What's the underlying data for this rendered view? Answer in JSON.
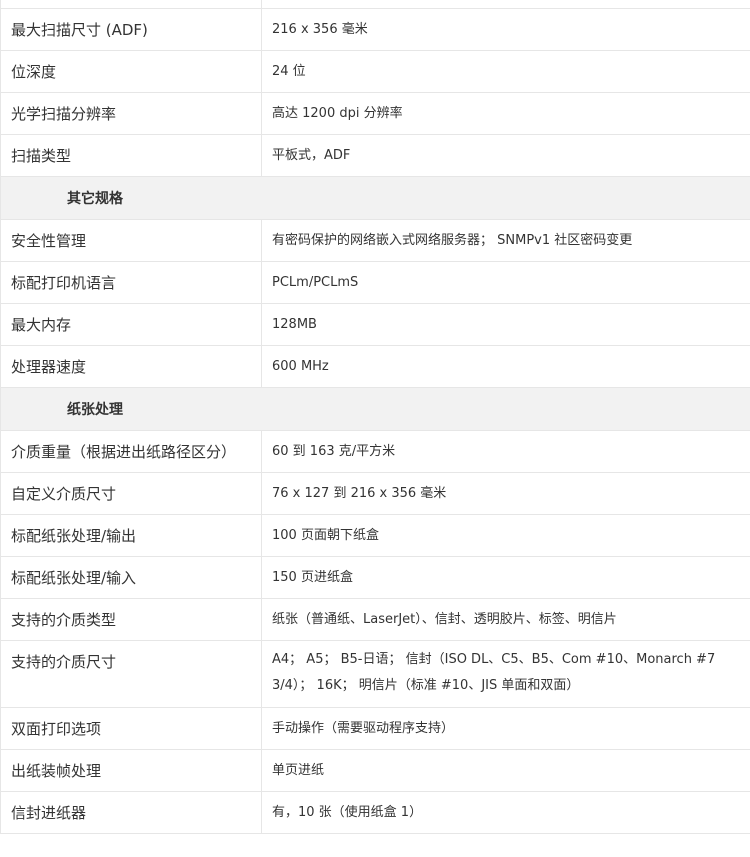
{
  "scan_specs": [
    {
      "label": "最大扫描尺寸 (ADF)",
      "value": "216 x 356 毫米"
    },
    {
      "label": "位深度",
      "value": "24 位"
    },
    {
      "label": "光学扫描分辨率",
      "value": "高达 1200 dpi 分辨率"
    },
    {
      "label": "扫描类型",
      "value": "平板式，ADF"
    }
  ],
  "other_section": {
    "title": "其它规格",
    "rows": [
      {
        "label": "安全性管理",
        "value": "有密码保护的网络嵌入式网络服务器； SNMPv1 社区密码变更"
      },
      {
        "label": "标配打印机语言",
        "value": "PCLm/PCLmS"
      },
      {
        "label": "最大内存",
        "value": "128MB"
      },
      {
        "label": "处理器速度",
        "value": "600 MHz"
      }
    ]
  },
  "paper_section": {
    "title": "纸张处理",
    "rows": [
      {
        "label": "介质重量（根据进出纸路径区分）",
        "value": "60 到 163 克/平方米"
      },
      {
        "label": "自定义介质尺寸",
        "value": "76 x 127 到 216 x 356 毫米"
      },
      {
        "label": "标配纸张处理/输出",
        "value": "100 页面朝下纸盒"
      },
      {
        "label": "标配纸张处理/输入",
        "value": "150 页进纸盒"
      },
      {
        "label": "支持的介质类型",
        "value": "纸张（普通纸、LaserJet）、信封、透明胶片、标签、明信片"
      },
      {
        "label": "支持的介质尺寸",
        "value": "A4； A5； B5-日语； 信封（ISO DL、C5、B5、Com #10、Monarch #7 3/4）； 16K； 明信片（标准 #10、JIS 单面和双面）"
      },
      {
        "label": "双面打印选项",
        "value": "手动操作（需要驱动程序支持）"
      },
      {
        "label": "出纸装帧处理",
        "value": "单页进纸"
      },
      {
        "label": "信封进纸器",
        "value": "有，10 张（使用纸盒 1）"
      }
    ]
  }
}
